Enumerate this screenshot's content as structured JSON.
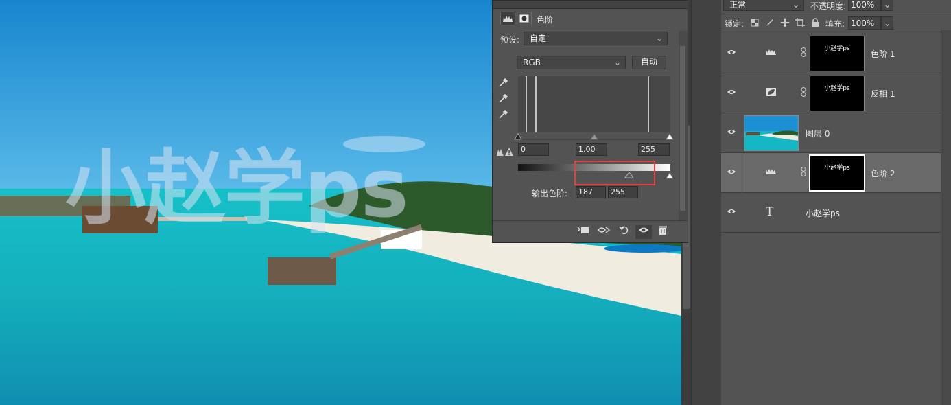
{
  "canvas": {
    "watermark": "小赵学ps"
  },
  "properties_panel": {
    "title": "色阶",
    "preset_label": "预设:",
    "preset_value": "自定",
    "channel": "RGB",
    "auto_button": "自动",
    "input_black": "0",
    "input_gamma": "1.00",
    "input_white": "255",
    "output_label": "输出色阶:",
    "output_black": "187",
    "output_white": "255",
    "highlight_color": "#e8403e"
  },
  "layers_panel": {
    "blend_mode": "正常",
    "opacity_label": "不透明度:",
    "opacity_value": "100%",
    "lock_label": "锁定:",
    "fill_label": "填充:",
    "fill_value": "100%",
    "layers": [
      {
        "name": "色阶 1",
        "type": "adjustment-levels",
        "mask_text": "小赵学ps",
        "selected": false
      },
      {
        "name": "反相 1",
        "type": "adjustment-invert",
        "mask_text": "小赵学ps",
        "selected": false
      },
      {
        "name": "图层 0",
        "type": "image",
        "selected": false
      },
      {
        "name": "色阶 2",
        "type": "adjustment-levels",
        "mask_text": "小赵学ps",
        "selected": true
      },
      {
        "name": "小赵学ps",
        "type": "text",
        "selected": false
      }
    ]
  }
}
